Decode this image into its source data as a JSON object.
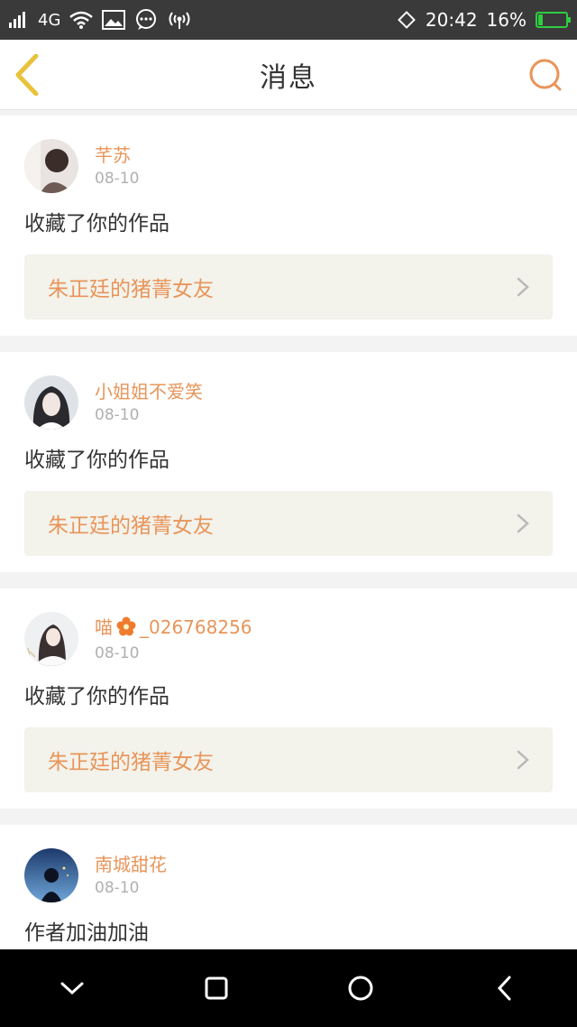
{
  "status_bar": {
    "network": "4G",
    "time": "20:42",
    "battery_text": "16%",
    "battery_level": 0.16,
    "battery_color": "#2ecc40"
  },
  "header": {
    "title": "消息",
    "back_icon": "chevron-left-icon",
    "search_icon": "search-icon",
    "accent": "#e8c23a"
  },
  "accent_color": "#e8955a",
  "messages": [
    {
      "user": "芊苏",
      "date": "08-10",
      "action": "收藏了你的作品",
      "work_title": "朱正廷的猪菁女友"
    },
    {
      "user": "小姐姐不爱笑",
      "date": "08-10",
      "action": "收藏了你的作品",
      "work_title": "朱正廷的猪菁女友"
    },
    {
      "user": "喵",
      "user_suffix": "_026768256",
      "date": "08-10",
      "action": "收藏了你的作品",
      "work_title": "朱正廷的猪菁女友"
    },
    {
      "user": "南城甜花",
      "date": "08-10",
      "action": "作者加油加油"
    }
  ],
  "system_nav": {
    "buttons": [
      "hide-icon",
      "recents-icon",
      "home-icon",
      "back-icon"
    ]
  }
}
